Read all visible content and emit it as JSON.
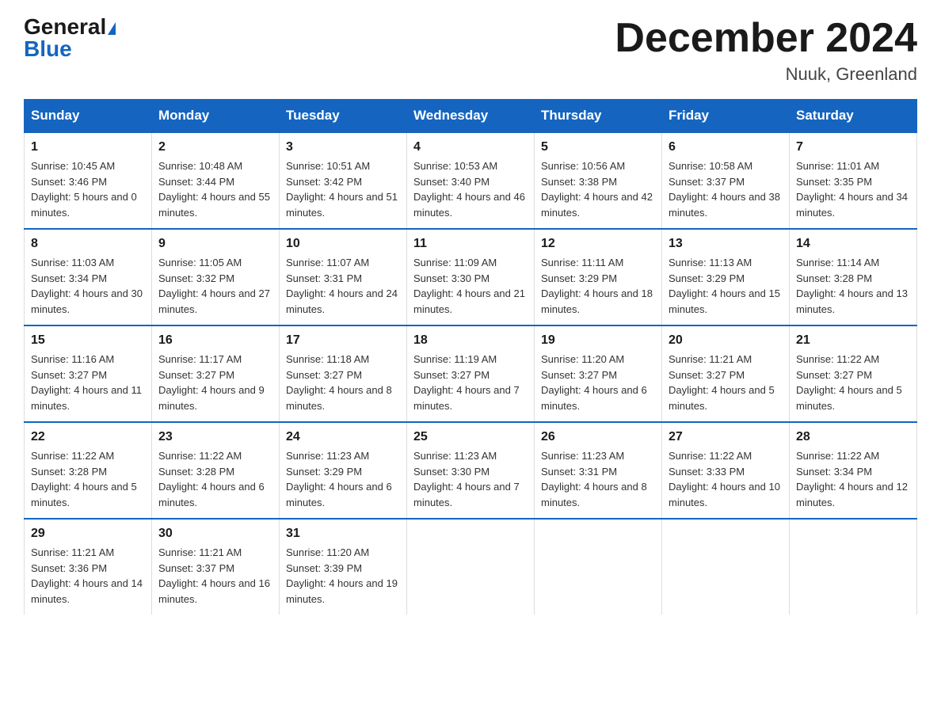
{
  "header": {
    "logo_general": "General",
    "logo_blue": "Blue",
    "month_title": "December 2024",
    "location": "Nuuk, Greenland"
  },
  "days_of_week": [
    "Sunday",
    "Monday",
    "Tuesday",
    "Wednesday",
    "Thursday",
    "Friday",
    "Saturday"
  ],
  "weeks": [
    [
      {
        "day": "1",
        "sunrise": "10:45 AM",
        "sunset": "3:46 PM",
        "daylight": "5 hours and 0 minutes."
      },
      {
        "day": "2",
        "sunrise": "10:48 AM",
        "sunset": "3:44 PM",
        "daylight": "4 hours and 55 minutes."
      },
      {
        "day": "3",
        "sunrise": "10:51 AM",
        "sunset": "3:42 PM",
        "daylight": "4 hours and 51 minutes."
      },
      {
        "day": "4",
        "sunrise": "10:53 AM",
        "sunset": "3:40 PM",
        "daylight": "4 hours and 46 minutes."
      },
      {
        "day": "5",
        "sunrise": "10:56 AM",
        "sunset": "3:38 PM",
        "daylight": "4 hours and 42 minutes."
      },
      {
        "day": "6",
        "sunrise": "10:58 AM",
        "sunset": "3:37 PM",
        "daylight": "4 hours and 38 minutes."
      },
      {
        "day": "7",
        "sunrise": "11:01 AM",
        "sunset": "3:35 PM",
        "daylight": "4 hours and 34 minutes."
      }
    ],
    [
      {
        "day": "8",
        "sunrise": "11:03 AM",
        "sunset": "3:34 PM",
        "daylight": "4 hours and 30 minutes."
      },
      {
        "day": "9",
        "sunrise": "11:05 AM",
        "sunset": "3:32 PM",
        "daylight": "4 hours and 27 minutes."
      },
      {
        "day": "10",
        "sunrise": "11:07 AM",
        "sunset": "3:31 PM",
        "daylight": "4 hours and 24 minutes."
      },
      {
        "day": "11",
        "sunrise": "11:09 AM",
        "sunset": "3:30 PM",
        "daylight": "4 hours and 21 minutes."
      },
      {
        "day": "12",
        "sunrise": "11:11 AM",
        "sunset": "3:29 PM",
        "daylight": "4 hours and 18 minutes."
      },
      {
        "day": "13",
        "sunrise": "11:13 AM",
        "sunset": "3:29 PM",
        "daylight": "4 hours and 15 minutes."
      },
      {
        "day": "14",
        "sunrise": "11:14 AM",
        "sunset": "3:28 PM",
        "daylight": "4 hours and 13 minutes."
      }
    ],
    [
      {
        "day": "15",
        "sunrise": "11:16 AM",
        "sunset": "3:27 PM",
        "daylight": "4 hours and 11 minutes."
      },
      {
        "day": "16",
        "sunrise": "11:17 AM",
        "sunset": "3:27 PM",
        "daylight": "4 hours and 9 minutes."
      },
      {
        "day": "17",
        "sunrise": "11:18 AM",
        "sunset": "3:27 PM",
        "daylight": "4 hours and 8 minutes."
      },
      {
        "day": "18",
        "sunrise": "11:19 AM",
        "sunset": "3:27 PM",
        "daylight": "4 hours and 7 minutes."
      },
      {
        "day": "19",
        "sunrise": "11:20 AM",
        "sunset": "3:27 PM",
        "daylight": "4 hours and 6 minutes."
      },
      {
        "day": "20",
        "sunrise": "11:21 AM",
        "sunset": "3:27 PM",
        "daylight": "4 hours and 5 minutes."
      },
      {
        "day": "21",
        "sunrise": "11:22 AM",
        "sunset": "3:27 PM",
        "daylight": "4 hours and 5 minutes."
      }
    ],
    [
      {
        "day": "22",
        "sunrise": "11:22 AM",
        "sunset": "3:28 PM",
        "daylight": "4 hours and 5 minutes."
      },
      {
        "day": "23",
        "sunrise": "11:22 AM",
        "sunset": "3:28 PM",
        "daylight": "4 hours and 6 minutes."
      },
      {
        "day": "24",
        "sunrise": "11:23 AM",
        "sunset": "3:29 PM",
        "daylight": "4 hours and 6 minutes."
      },
      {
        "day": "25",
        "sunrise": "11:23 AM",
        "sunset": "3:30 PM",
        "daylight": "4 hours and 7 minutes."
      },
      {
        "day": "26",
        "sunrise": "11:23 AM",
        "sunset": "3:31 PM",
        "daylight": "4 hours and 8 minutes."
      },
      {
        "day": "27",
        "sunrise": "11:22 AM",
        "sunset": "3:33 PM",
        "daylight": "4 hours and 10 minutes."
      },
      {
        "day": "28",
        "sunrise": "11:22 AM",
        "sunset": "3:34 PM",
        "daylight": "4 hours and 12 minutes."
      }
    ],
    [
      {
        "day": "29",
        "sunrise": "11:21 AM",
        "sunset": "3:36 PM",
        "daylight": "4 hours and 14 minutes."
      },
      {
        "day": "30",
        "sunrise": "11:21 AM",
        "sunset": "3:37 PM",
        "daylight": "4 hours and 16 minutes."
      },
      {
        "day": "31",
        "sunrise": "11:20 AM",
        "sunset": "3:39 PM",
        "daylight": "4 hours and 19 minutes."
      },
      null,
      null,
      null,
      null
    ]
  ]
}
